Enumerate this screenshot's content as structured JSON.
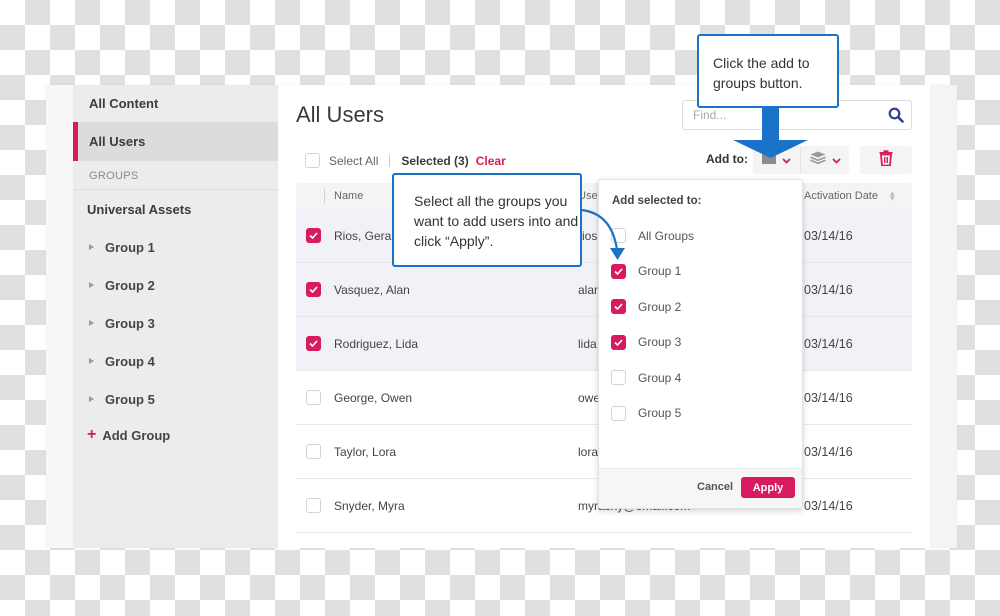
{
  "sidebar": {
    "all_content": "All Content",
    "all_users": "All Users",
    "groups_section": "GROUPS",
    "universal_assets": "Universal Assets",
    "groups": [
      "Group 1",
      "Group 2",
      "Group 3",
      "Group 4",
      "Group 5"
    ],
    "add_group": "Add Group"
  },
  "main": {
    "title": "All Users",
    "search_placeholder": "Find...",
    "select_all": "Select All",
    "selected": "Selected (3)",
    "clear": "Clear",
    "add_to_label": "Add to:"
  },
  "table": {
    "headers": {
      "name": "Name",
      "username": "Use",
      "activation_date": "Activation Date"
    },
    "rows": [
      {
        "name": "Rios, Geral",
        "username": "rios",
        "date": "03/14/16",
        "selected": true
      },
      {
        "name": "Vasquez, Alan",
        "username": "alan",
        "date": "03/14/16",
        "selected": true
      },
      {
        "name": "Rodriguez, Lida",
        "username": "lida",
        "date": "03/14/16",
        "selected": true
      },
      {
        "name": "George, Owen",
        "username": "owe",
        "date": "03/14/16",
        "selected": false
      },
      {
        "name": "Taylor, Lora",
        "username": "lora",
        "date": "03/14/16",
        "selected": false
      },
      {
        "name": "Snyder, Myra",
        "username": "myrashy@email.com",
        "date": "03/14/16",
        "selected": false
      }
    ]
  },
  "dropdown": {
    "title": "Add selected to:",
    "options": [
      {
        "label": "All Groups",
        "checked": false
      },
      {
        "label": "Group 1",
        "checked": true
      },
      {
        "label": "Group 2",
        "checked": true
      },
      {
        "label": "Group 3",
        "checked": true
      },
      {
        "label": "Group 4",
        "checked": false
      },
      {
        "label": "Group 5",
        "checked": false
      }
    ],
    "cancel": "Cancel",
    "apply": "Apply"
  },
  "callouts": {
    "top": "Click the add to groups button.",
    "middle": "Select all the groups you want to add users into and click “Apply”."
  },
  "colors": {
    "accent": "#d81b60",
    "callout_blue": "#1a73c8",
    "search_icon": "#2b3f8c"
  }
}
